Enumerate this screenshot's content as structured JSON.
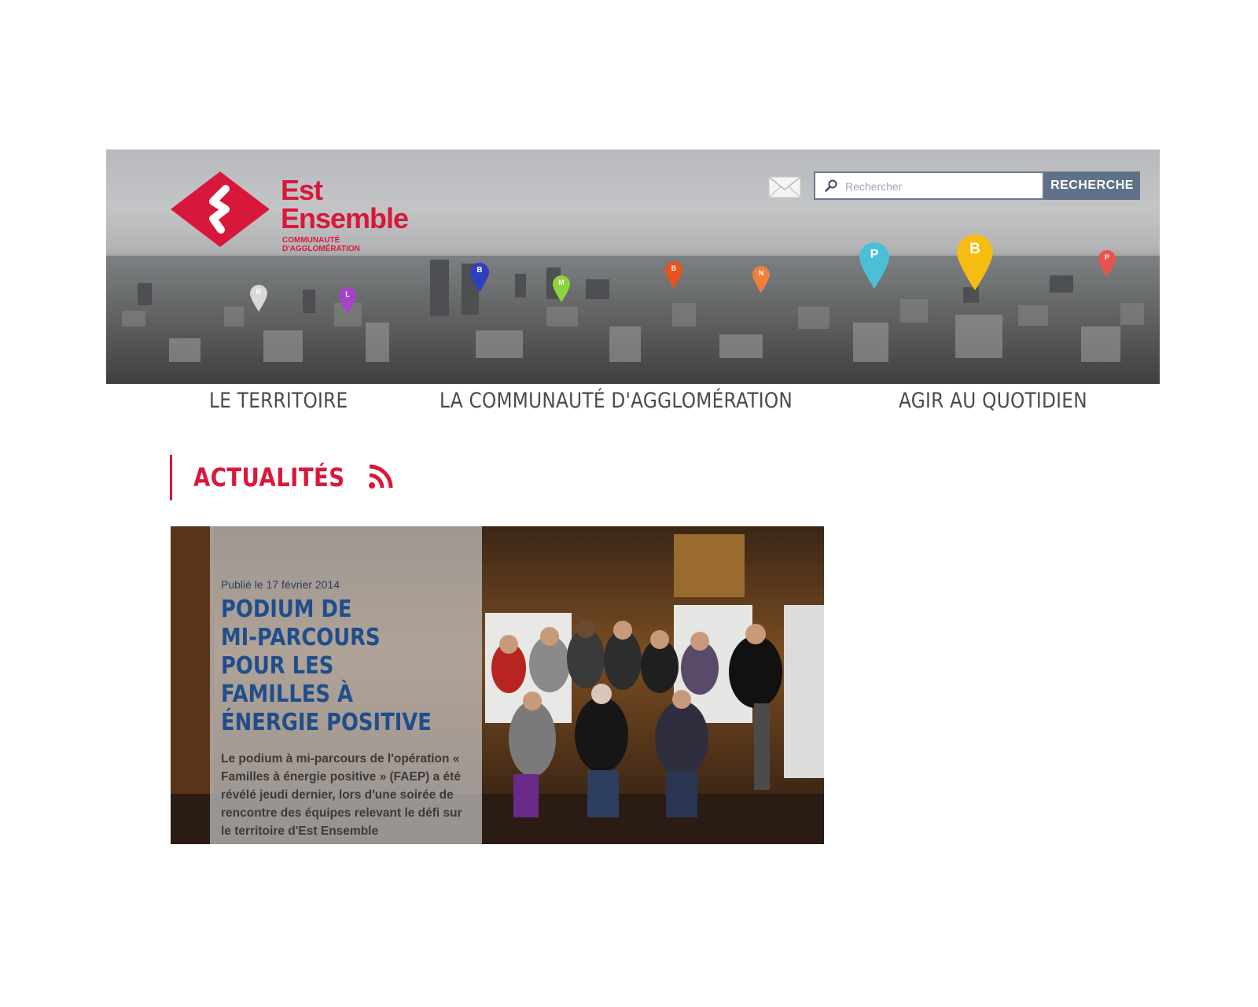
{
  "brand": {
    "name_line1": "Est",
    "name_line2": "Ensemble",
    "sub_line1": "COMMUNAUTÉ",
    "sub_line2": "D'AGGLOMÉRATION",
    "color": "#d8183a"
  },
  "header": {
    "mail_icon": "envelope-icon",
    "search": {
      "placeholder": "Rechercher",
      "value": "",
      "button_label": "RECHERCHE",
      "icon": "search-icon"
    },
    "map_pins": [
      {
        "letter": "R",
        "color": "#d9d9d9"
      },
      {
        "letter": "L",
        "color": "#a544c9"
      },
      {
        "letter": "B",
        "color": "#2e3fbf"
      },
      {
        "letter": "M",
        "color": "#8cd43a"
      },
      {
        "letter": "B",
        "color": "#e9531f"
      },
      {
        "letter": "N",
        "color": "#f07f3c"
      },
      {
        "letter": "P",
        "color": "#4bbfd6"
      },
      {
        "letter": "B",
        "color": "#f5bd12"
      },
      {
        "letter": "P",
        "color": "#e9534d"
      }
    ]
  },
  "nav": {
    "items": [
      {
        "label": "LE TERRITOIRE"
      },
      {
        "label": "LA COMMUNAUTÉ D'AGGLOMÉRATION"
      },
      {
        "label": "AGIR AU QUOTIDIEN"
      }
    ]
  },
  "news": {
    "section_title": "ACTUALITÉS",
    "rss_icon": "rss-icon",
    "feature": {
      "date": "Publié le 17 février 2014",
      "title_lines": [
        "PODIUM DE",
        "MI-PARCOURS",
        "POUR LES",
        "FAMILLES À",
        "ÉNERGIE POSITIVE"
      ],
      "excerpt": "Le podium à mi-parcours de l'opération « Familles à énergie positive » (FAEP) a été révélé jeudi dernier, lors d'une soirée de rencontre des équipes relevant le défi sur le territoire d'Est Ensemble"
    }
  }
}
